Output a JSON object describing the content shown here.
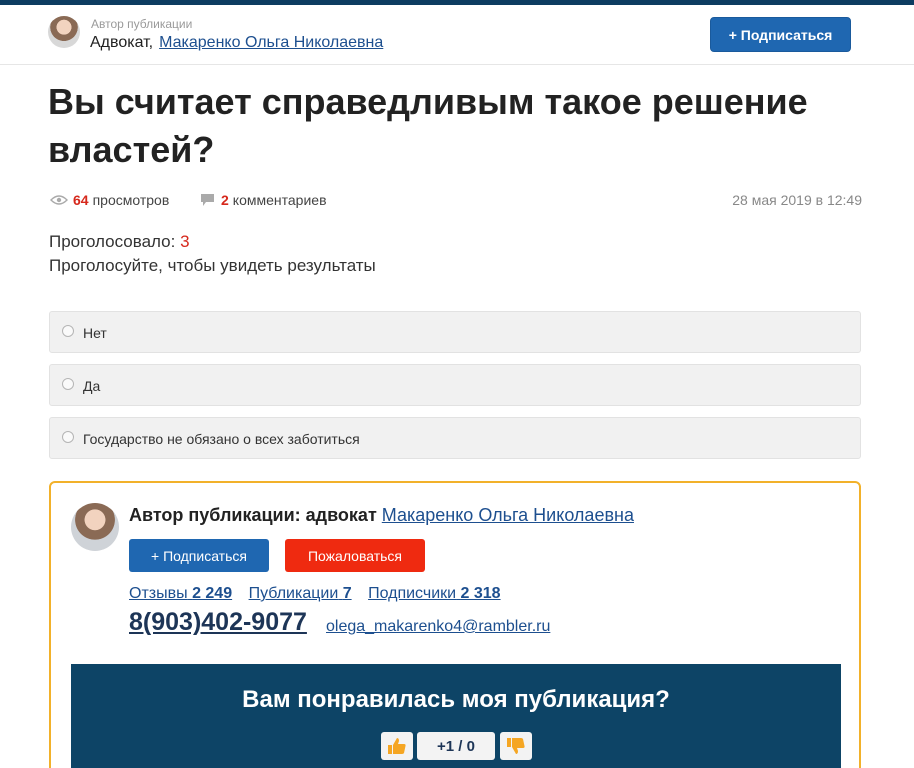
{
  "header": {
    "meta_label": "Автор публикации",
    "role": "Адвокат,",
    "author_name": "Макаренко Ольга Николаевна",
    "subscribe_label": "+ Подписаться"
  },
  "article": {
    "title": "Вы считает справедливым такое решение властей?",
    "views_count": "64",
    "views_label": "просмотров",
    "comments_count": "2",
    "comments_label": "комментариев",
    "date": "28 мая 2019 в 12:49"
  },
  "poll": {
    "voted_label": "Проголосовало:",
    "voted_count": "3",
    "hint": "Проголосуйте, чтобы увидеть результаты",
    "options": [
      {
        "label": "Нет"
      },
      {
        "label": "Да"
      },
      {
        "label": "Государство не обязано о всех заботиться"
      }
    ]
  },
  "author_box": {
    "title_prefix": "Автор публикации: адвокат",
    "author_name": "Макаренко Ольга Николаевна",
    "subscribe_label": "+ Подписаться",
    "report_label": "Пожаловаться",
    "reviews_label": "Отзывы",
    "reviews_count": "2 249",
    "publications_label": "Публикации",
    "publications_count": "7",
    "subscribers_label": "Подписчики",
    "subscribers_count": "2 318",
    "phone": "8(903)402-9077",
    "email": "olega_makarenko4@rambler.ru"
  },
  "like_panel": {
    "question": "Вам понравилась моя публикация?",
    "score": "+1 / 0"
  },
  "colors": {
    "accent_blue": "#1f67b1",
    "report_red": "#ef2a10",
    "count_red": "#d6281c",
    "panel_navy": "#0d4466",
    "box_border": "#f2b12a"
  }
}
